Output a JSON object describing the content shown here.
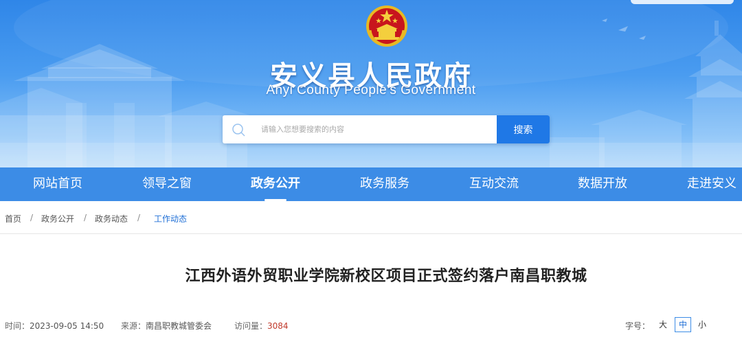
{
  "site": {
    "title": "安义县人民政府",
    "subtitle": "Anyi County People's Government"
  },
  "search": {
    "placeholder": "请输入您想要搜索的内容",
    "button_label": "搜索"
  },
  "nav": {
    "items": [
      {
        "label": "网站首页"
      },
      {
        "label": "领导之窗"
      },
      {
        "label": "政务公开",
        "active": true
      },
      {
        "label": "政务服务"
      },
      {
        "label": "互动交流"
      },
      {
        "label": "数据开放"
      },
      {
        "label": "走进安义"
      }
    ]
  },
  "breadcrumb": {
    "items": [
      "首页",
      "政务公开",
      "政务动态",
      "工作动态"
    ],
    "separator": "/"
  },
  "article": {
    "title": "江西外语外贸职业学院新校区项目正式签约落户南昌职教城",
    "time_label": "时间：",
    "time_value": "2023-09-05 14:50",
    "source_label": "来源：",
    "source_value": "南昌职教城管委会",
    "views_label": "访问量：",
    "views_value": "3084"
  },
  "font_size": {
    "label": "字号：",
    "options": [
      "大",
      "中",
      "小"
    ],
    "selected": "中"
  },
  "colors": {
    "banner_top": "#2f86e8",
    "nav_bg": "#3c8ce6",
    "search_button": "#1f78e6",
    "breadcrumb_current": "#1f6fd6",
    "views_count": "#c0392b"
  },
  "icons": {
    "emblem": "national-emblem-icon",
    "search": "search-icon"
  }
}
